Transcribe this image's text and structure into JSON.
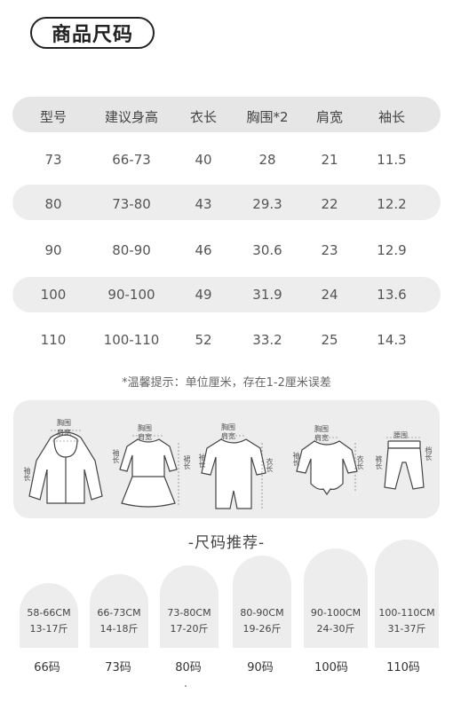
{
  "title": "商品尺码",
  "table": {
    "headers": [
      "型号",
      "建议身高",
      "衣长",
      "胸围*2",
      "肩宽",
      "袖长"
    ],
    "rows": [
      [
        "73",
        "66-73",
        "40",
        "28",
        "21",
        "11.5"
      ],
      [
        "80",
        "73-80",
        "43",
        "29.3",
        "22",
        "12.2"
      ],
      [
        "90",
        "80-90",
        "46",
        "30.6",
        "23",
        "12.9"
      ],
      [
        "100",
        "90-100",
        "49",
        "31.9",
        "24",
        "13.6"
      ],
      [
        "110",
        "100-110",
        "52",
        "33.2",
        "25",
        "14.3"
      ]
    ]
  },
  "note": "*温馨提示：单位厘米，存在1-2厘米误差",
  "figures": {
    "jacket": {
      "chest": "胸围",
      "shoulder": "肩宽",
      "sleeve": "袖长"
    },
    "dress": {
      "chest": "胸围",
      "shoulder": "肩宽",
      "sleeve": "袖长",
      "length": "裙长"
    },
    "romper": {
      "chest": "胸围",
      "shoulder": "肩宽",
      "sleeve": "袖长",
      "length": "衣长"
    },
    "bodysuit": {
      "chest": "胸围",
      "shoulder": "肩宽",
      "sleeve": "袖长",
      "length": "衣长"
    },
    "pants": {
      "waist": "腰围",
      "length": "裤长",
      "hip": "档长"
    }
  },
  "recommend_title": "-尺码推荐-",
  "recommend": [
    {
      "height": "58-66CM",
      "weight": "13-17斤",
      "size": "66码"
    },
    {
      "height": "66-73CM",
      "weight": "14-18斤",
      "size": "73码"
    },
    {
      "height": "73-80CM",
      "weight": "17-20斤",
      "size": "80码"
    },
    {
      "height": "80-90CM",
      "weight": "19-26斤",
      "size": "90码"
    },
    {
      "height": "90-100CM",
      "weight": "24-30斤",
      "size": "100码"
    },
    {
      "height": "100-110CM",
      "weight": "31-37斤",
      "size": "110码"
    }
  ]
}
